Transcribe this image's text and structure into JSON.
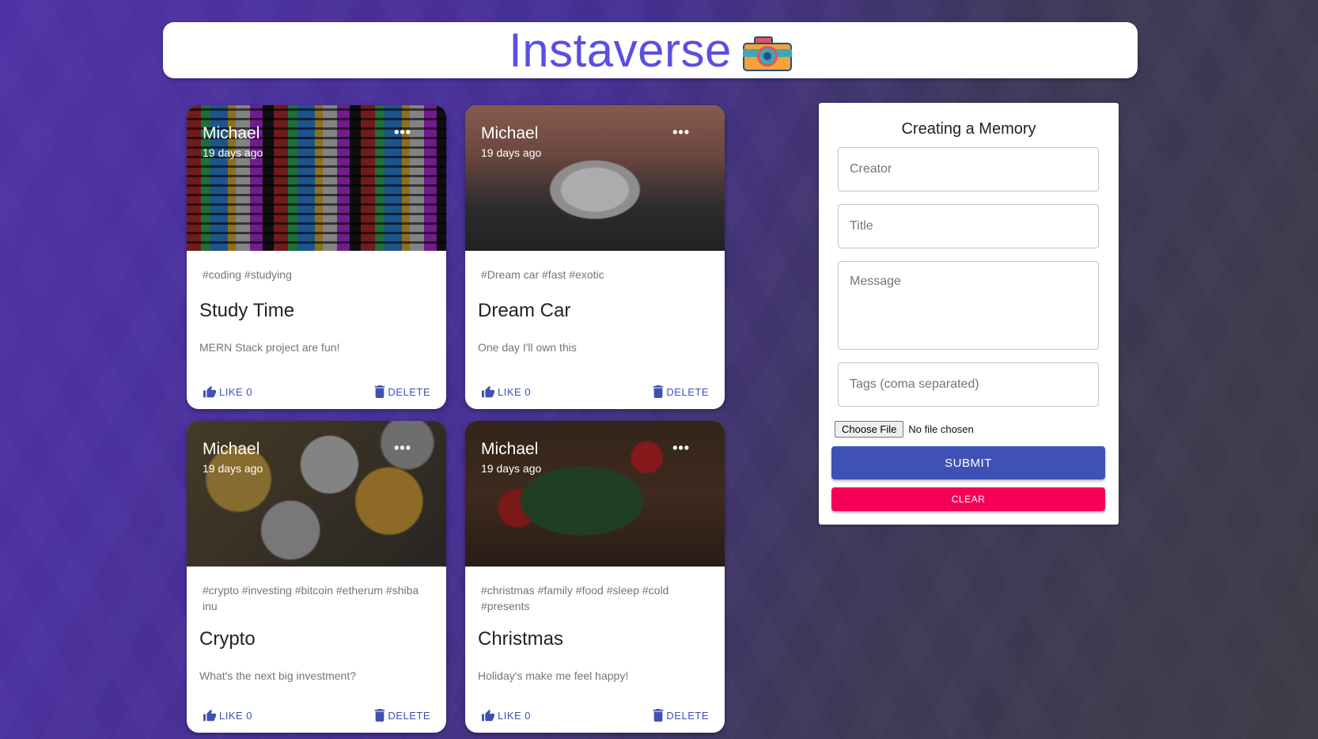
{
  "app": {
    "title": "Instaverse",
    "logo_icon": "camera-icon"
  },
  "posts": [
    {
      "creator": "Michael",
      "time": "19 days ago",
      "tags": "#coding #studying",
      "title": "Study Time",
      "message": "MERN Stack project are fun!",
      "like_label": "LIKE 0",
      "delete_label": "DELETE",
      "more": "•••"
    },
    {
      "creator": "Michael",
      "time": "19 days ago",
      "tags": "#Dream car #fast #exotic",
      "title": "Dream Car",
      "message": "One day I'll own this",
      "like_label": "LIKE 0",
      "delete_label": "DELETE",
      "more": "•••"
    },
    {
      "creator": "Michael",
      "time": "19 days ago",
      "tags": "#crypto #investing #bitcoin #etherum #shiba inu",
      "title": "Crypto",
      "message": "What's the next big investment?",
      "like_label": "LIKE 0",
      "delete_label": "DELETE",
      "more": "•••"
    },
    {
      "creator": "Michael",
      "time": "19 days ago",
      "tags": "#christmas #family #food #sleep #cold #presents",
      "title": "Christmas",
      "message": "Holiday's make me feel happy!",
      "like_label": "LIKE 0",
      "delete_label": "DELETE",
      "more": "•••"
    }
  ],
  "form": {
    "heading": "Creating a Memory",
    "creator_placeholder": "Creator",
    "title_placeholder": "Title",
    "message_placeholder": "Message",
    "tags_placeholder": "Tags (coma separated)",
    "choose_file_label": "Choose File",
    "no_file_text": "No file chosen",
    "submit_label": "SUBMIT",
    "clear_label": "CLEAR"
  },
  "colors": {
    "accent": "#5a4fe0",
    "primary": "#3f51b5",
    "secondary": "#f50057"
  }
}
